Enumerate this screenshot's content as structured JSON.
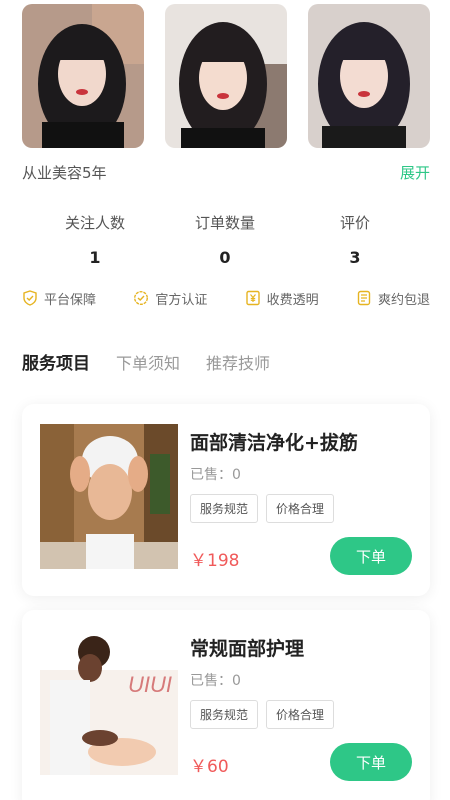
{
  "photos": [
    {
      "alt": "technician-photo-1"
    },
    {
      "alt": "technician-photo-2"
    },
    {
      "alt": "technician-photo-3"
    }
  ],
  "profile": {
    "description": "从业美容5年",
    "expand_label": "展开"
  },
  "stats": [
    {
      "label": "关注人数",
      "value": "1"
    },
    {
      "label": "订单数量",
      "value": "0"
    },
    {
      "label": "评价",
      "value": "3"
    }
  ],
  "guarantees": [
    {
      "label": "平台保障",
      "icon": "shield-check-icon"
    },
    {
      "label": "官方认证",
      "icon": "badge-check-icon"
    },
    {
      "label": "收费透明",
      "icon": "yen-receipt-icon"
    },
    {
      "label": "爽约包退",
      "icon": "refund-icon"
    }
  ],
  "tabs": [
    {
      "label": "服务项目",
      "active": true
    },
    {
      "label": "下单须知",
      "active": false
    },
    {
      "label": "推荐技师",
      "active": false
    }
  ],
  "services": [
    {
      "title": "面部清洁净化+拔筋",
      "sold": "已售：0",
      "tags": [
        "服务规范",
        "价格合理"
      ],
      "price": "￥198",
      "order_label": "下单"
    },
    {
      "title": "常规面部护理",
      "sold": "已售：0",
      "tags": [
        "服务规范",
        "价格合理"
      ],
      "price": "￥60",
      "order_label": "下单"
    }
  ],
  "colors": {
    "accent": "#2ec787",
    "price": "#f05a5a",
    "icon_gold": "#e6b422"
  }
}
